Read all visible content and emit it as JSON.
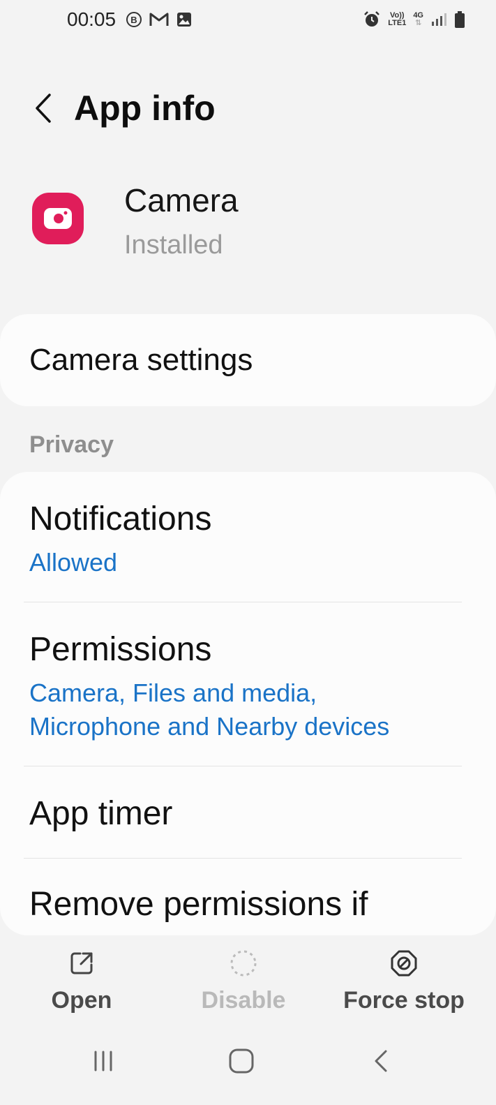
{
  "status_bar": {
    "time": "00:05",
    "network_top": "Vo))",
    "network_bottom": "LTE1",
    "data_type": "4G",
    "icons": [
      "b-icon",
      "gmail-icon",
      "gallery-icon",
      "alarm-icon",
      "signal-icon",
      "battery-icon"
    ]
  },
  "app_bar": {
    "title": "App info"
  },
  "app": {
    "name": "Camera",
    "status": "Installed",
    "icon_color": "#e01d5a"
  },
  "camera_settings": {
    "label": "Camera settings"
  },
  "privacy": {
    "section_label": "Privacy",
    "rows": [
      {
        "title": "Notifications",
        "sub": "Allowed"
      },
      {
        "title": "Permissions",
        "sub_line1": "Camera, Files and media,",
        "sub_line2": "Microphone and Nearby devices"
      },
      {
        "title": "App timer"
      },
      {
        "title": "Remove permissions if"
      }
    ]
  },
  "actions": {
    "open": "Open",
    "disable": "Disable",
    "force_stop": "Force stop"
  },
  "colors": {
    "background": "#f3f3f3",
    "card": "#fcfcfc",
    "accent_blue": "#1a73c7",
    "disabled_text": "#b9b9b9"
  }
}
